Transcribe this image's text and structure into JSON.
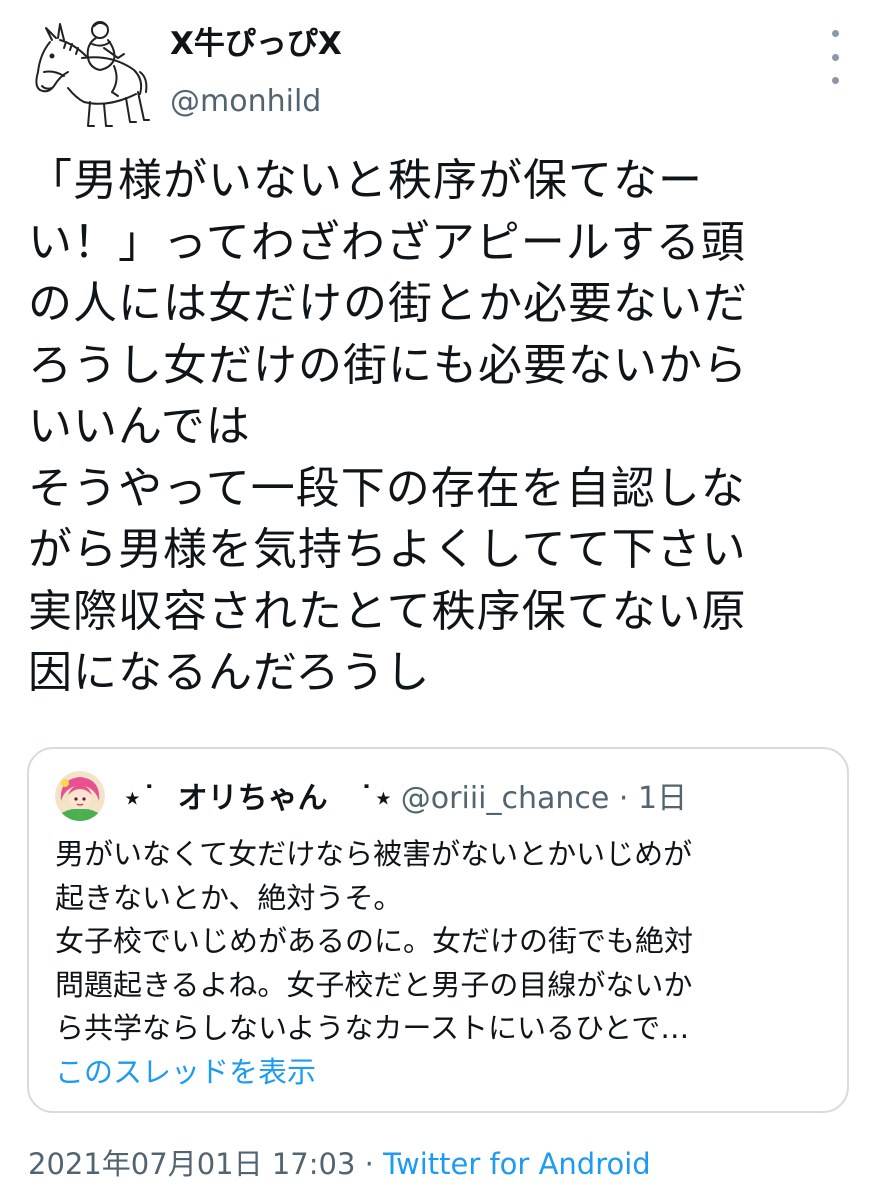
{
  "author": {
    "display_name": "X牛ぴっぴX",
    "handle": "@monhild",
    "avatar_icon": "donkey-rider-sketch-icon"
  },
  "more_icon": "more-vertical-icon",
  "tweet": {
    "lines": [
      "「男様がいないと秩序が保てなー",
      "い！」ってわざわざアピールする頭",
      "の人には女だけの街とか必要ないだ",
      "ろうし女だけの街にも必要ないから",
      "いいんでは",
      "そうやって一段下の存在を自認しな",
      "がら男様を気持ちよくしてて下さい",
      "実際収容されたとて秩序保てない原",
      "因になるんだろうし"
    ]
  },
  "quote": {
    "name_prefix": "⋆˙",
    "display_name": "オリちゃん",
    "name_suffix": "˙⋆",
    "handle": "@oriii_chance",
    "separator": "·",
    "time": "1日",
    "avatar_icon": "pink-hair-character-avatar-icon",
    "lines": [
      "男がいなくて女だけなら被害がないとかいじめが",
      "起きないとか、絶対うそ。",
      "女子校でいじめがあるのに。女だけの街でも絶対",
      "問題起きるよね。女子校だと男子の目線がないか",
      "ら共学ならしないようなカーストにいるひとで…"
    ],
    "show_thread_label": "このスレッドを表示"
  },
  "footer": {
    "timestamp": "2021年07月01日 17:03",
    "separator": " · ",
    "source": "Twitter for Android"
  },
  "colors": {
    "text": "#0f1419",
    "secondary": "#536471",
    "link": "#1d9bf0",
    "border": "#d5dbe0"
  }
}
